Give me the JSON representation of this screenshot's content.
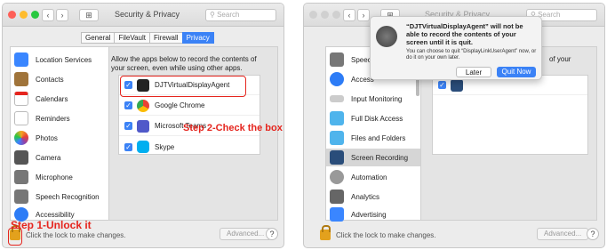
{
  "left_window": {
    "title": "Security & Privacy",
    "search_placeholder": "Search",
    "tabs": [
      "General",
      "FileVault",
      "Firewall",
      "Privacy"
    ],
    "active_tab": "Privacy",
    "description": "Allow the apps below to record the contents of your screen, even while using other apps.",
    "sidebar": [
      {
        "label": "Location Services",
        "icon": "location-icon",
        "color": "#3a86ff"
      },
      {
        "label": "Contacts",
        "icon": "contacts-icon",
        "color": "#a0743a"
      },
      {
        "label": "Calendars",
        "icon": "calendar-icon",
        "color": "#ffffff"
      },
      {
        "label": "Reminders",
        "icon": "reminders-icon",
        "color": "#ffffff"
      },
      {
        "label": "Photos",
        "icon": "photos-icon",
        "color": "#f5a623"
      },
      {
        "label": "Camera",
        "icon": "camera-icon",
        "color": "#555555"
      },
      {
        "label": "Microphone",
        "icon": "microphone-icon",
        "color": "#777777"
      },
      {
        "label": "Speech Recognition",
        "icon": "speech-icon",
        "color": "#777777"
      },
      {
        "label": "Accessibility",
        "icon": "accessibility-icon",
        "color": "#2d7cf6"
      }
    ],
    "apps": [
      {
        "label": "DJTVirtualDisplayAgent",
        "icon": "display-agent-icon",
        "color": "#222222"
      },
      {
        "label": "Google Chrome",
        "icon": "chrome-icon",
        "color": "#e94235"
      },
      {
        "label": "Microsoft Teams",
        "icon": "teams-icon",
        "color": "#5059c9"
      },
      {
        "label": "Skype",
        "icon": "skype-icon",
        "color": "#00aff0"
      }
    ],
    "lock_text": "Click the lock to make changes.",
    "advanced_label": "Advanced...",
    "help_label": "?"
  },
  "annotations": {
    "step1": "Step 1-Unlock it",
    "step2": "Step 2-Check the box"
  },
  "right_window": {
    "title": "Security & Privacy",
    "search_placeholder": "Search",
    "dialog": {
      "title": "“DJTVirtualDisplayAgent” will not be able to record the contents of your screen until it is quit.",
      "body": "You can choose to quit “DisplayLinkUserAgent” now, or do it on your own later.",
      "later_label": "Later",
      "quit_label": "Quit Now"
    },
    "partial_description": "of your",
    "sidebar": [
      {
        "label": "Speech",
        "icon": "speech-icon"
      },
      {
        "label": "Access",
        "icon": "accessibility-icon"
      },
      {
        "label": "Input Monitoring",
        "icon": "keyboard-icon"
      },
      {
        "label": "Full Disk Access",
        "icon": "folder-icon"
      },
      {
        "label": "Files and Folders",
        "icon": "folder-icon"
      },
      {
        "label": "Screen Recording",
        "icon": "screen-recording-icon"
      },
      {
        "label": "Automation",
        "icon": "gear-icon"
      },
      {
        "label": "Analytics",
        "icon": "analytics-icon"
      },
      {
        "label": "Advertising",
        "icon": "megaphone-icon"
      }
    ],
    "selected_sidebar": "Screen Recording",
    "lock_text": "Click the lock to make changes.",
    "advanced_label": "Advanced...",
    "help_label": "?"
  }
}
